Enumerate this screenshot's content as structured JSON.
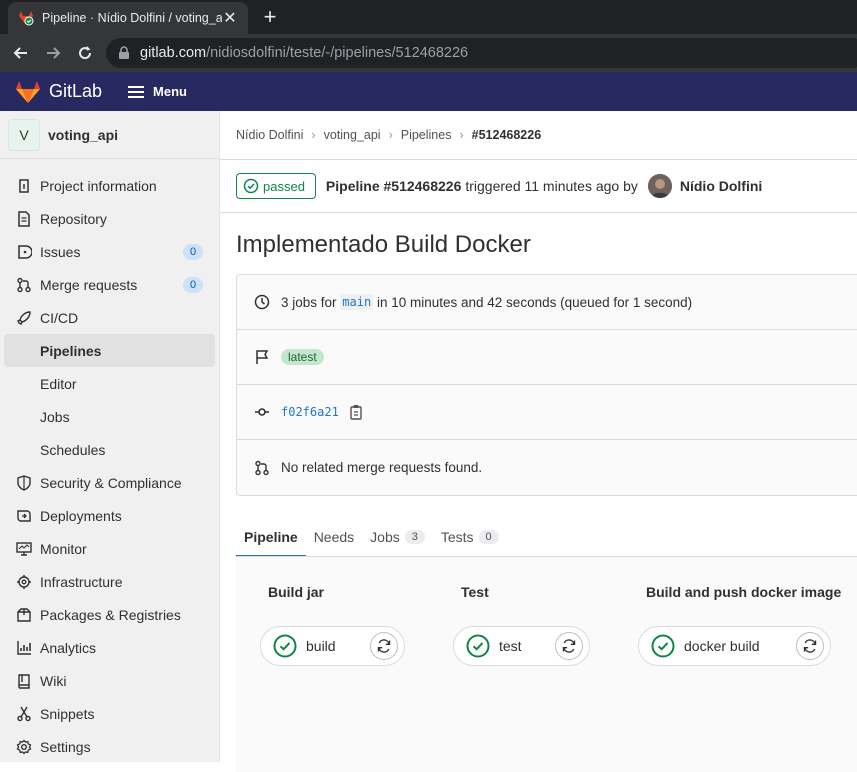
{
  "browser": {
    "tab_title": "Pipeline · Nídio Dolfini / voting_a",
    "url_host": "gitlab.com",
    "url_path": "/nidiosdolfini/teste/-/pipelines/512468226"
  },
  "header": {
    "logo_text": "GitLab",
    "menu_label": "Menu",
    "brand_color": "#292961"
  },
  "sidebar": {
    "project_initial": "V",
    "project_name": "voting_api",
    "items": [
      {
        "label": "Project information",
        "icon": "info-icon"
      },
      {
        "label": "Repository",
        "icon": "document-icon"
      },
      {
        "label": "Issues",
        "icon": "issues-icon",
        "badge": "0"
      },
      {
        "label": "Merge requests",
        "icon": "merge-request-icon",
        "badge": "0"
      },
      {
        "label": "CI/CD",
        "icon": "rocket-icon"
      }
    ],
    "ci_sub": [
      "Pipelines",
      "Editor",
      "Jobs",
      "Schedules"
    ],
    "more_items": [
      {
        "label": "Security & Compliance",
        "icon": "shield-icon"
      },
      {
        "label": "Deployments",
        "icon": "deployments-icon"
      },
      {
        "label": "Monitor",
        "icon": "monitor-icon"
      },
      {
        "label": "Infrastructure",
        "icon": "cloud-gear-icon"
      },
      {
        "label": "Packages & Registries",
        "icon": "package-icon"
      },
      {
        "label": "Analytics",
        "icon": "chart-icon"
      },
      {
        "label": "Wiki",
        "icon": "book-icon"
      },
      {
        "label": "Snippets",
        "icon": "scissors-icon"
      },
      {
        "label": "Settings",
        "icon": "gear-icon"
      }
    ]
  },
  "breadcrumb": [
    "Nídio Dolfini",
    "voting_api",
    "Pipelines",
    "#512468226"
  ],
  "pipeline": {
    "status": "passed",
    "title": "Pipeline #512468226",
    "triggered_text": "triggered 11 minutes ago by",
    "user": "Nídio Dolfini"
  },
  "commit_title": "Implementado Build Docker",
  "info": {
    "jobs_prefix": "3 jobs for",
    "branch": "main",
    "jobs_suffix": "in 10 minutes and 42 seconds (queued for 1 second)",
    "tag": "latest",
    "sha": "f02f6a21",
    "merge_requests": "No related merge requests found."
  },
  "tabs": [
    {
      "label": "Pipeline"
    },
    {
      "label": "Needs"
    },
    {
      "label": "Jobs",
      "count": "3"
    },
    {
      "label": "Tests",
      "count": "0"
    }
  ],
  "stages": [
    {
      "title": "Build jar",
      "job": "build"
    },
    {
      "title": "Test",
      "job": "test"
    },
    {
      "title": "Build and push docker image",
      "job": "docker build"
    }
  ],
  "colors": {
    "success": "#108548",
    "link": "#1f75cb"
  }
}
